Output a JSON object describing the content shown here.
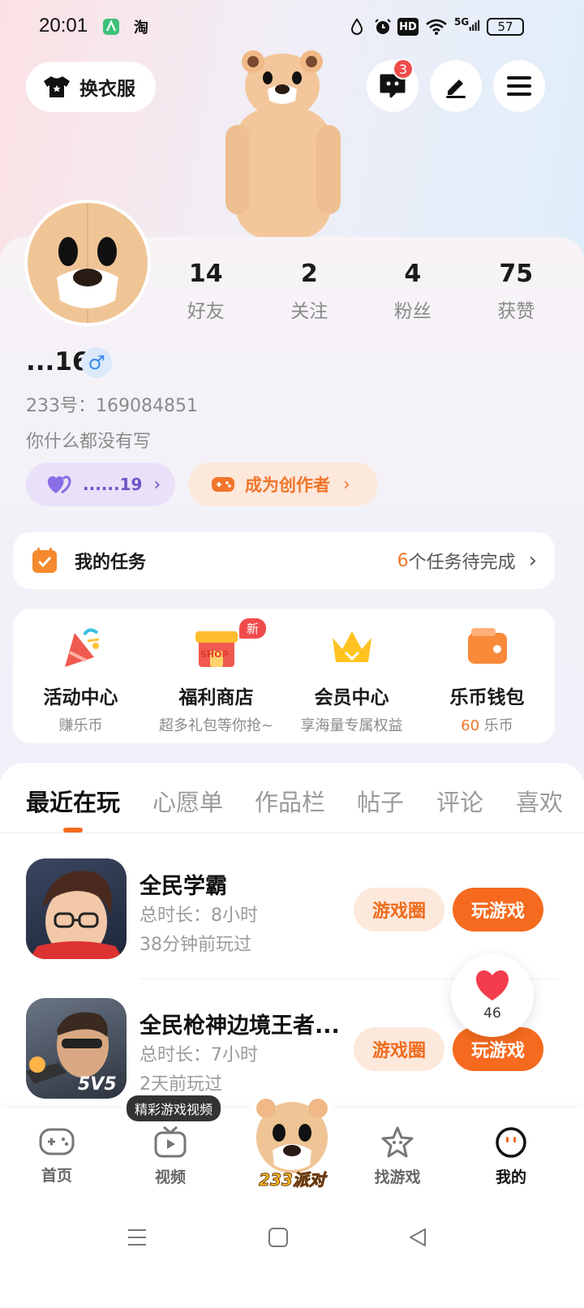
{
  "status_bar": {
    "time": "20:01",
    "carrier_icon": "淘",
    "network": "5G",
    "hd": "HD",
    "battery": "57"
  },
  "header": {
    "dress_button": "换衣服",
    "message_badge": "3"
  },
  "profile": {
    "stats": [
      {
        "num": "14",
        "label": "好友"
      },
      {
        "num": "2",
        "label": "关注"
      },
      {
        "num": "4",
        "label": "粉丝"
      },
      {
        "num": "75",
        "label": "获赞"
      }
    ],
    "name": "...16",
    "gender_symbol": "♂",
    "id_text": "233号：169084851",
    "bio": "你什么都没有写",
    "tag1": "......19",
    "creator_btn": "成为创作者"
  },
  "tasks": {
    "label": "我的任务",
    "count": "6",
    "suffix": " 个任务待完成"
  },
  "features": [
    {
      "title": "活动中心",
      "sub": "赚乐币"
    },
    {
      "title": "福利商店",
      "sub": "超多礼包等你抢~",
      "badge": "新",
      "sign": "SHOP"
    },
    {
      "title": "会员中心",
      "sub": "享海量专属权益"
    },
    {
      "title": "乐币钱包",
      "sub_num": "60",
      "sub_unit": " 乐币"
    }
  ],
  "tabs": [
    "最近在玩",
    "心愿单",
    "作品栏",
    "帖子",
    "评论",
    "喜欢"
  ],
  "games": [
    {
      "title": "全民学霸",
      "duration": "总时长：8小时",
      "last": "38分钟前玩过",
      "btn_circle": "游戏圈",
      "btn_play": "玩游戏"
    },
    {
      "title": "全民枪神边境王者...",
      "duration": "总时长：7小时",
      "last": "2天前玩过",
      "btn_circle": "游戏圈",
      "btn_play": "玩游戏",
      "icon_text": "5V5"
    }
  ],
  "floating_like": {
    "count": "46"
  },
  "bottom_nav": {
    "tooltip": "精彩游戏视频",
    "items": [
      "首页",
      "视频",
      "找游戏",
      "我的"
    ],
    "center_label": "233派对"
  },
  "colors": {
    "accent": "#f56a1e",
    "purple_tag": "#ece6fb",
    "orange_tag": "#fdebdf"
  }
}
